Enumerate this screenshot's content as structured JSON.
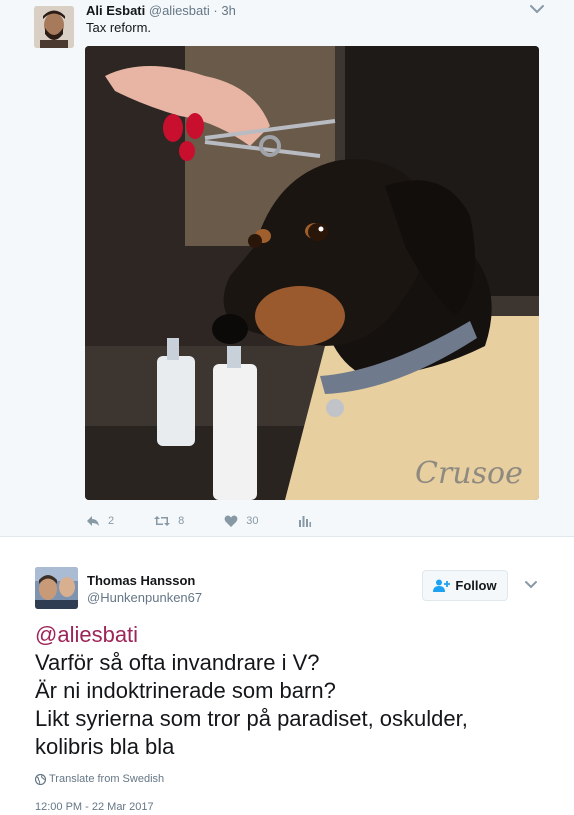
{
  "quoted_tweet": {
    "author_name": "Ali Esbati",
    "author_handle": "@aliesbati",
    "time": "3h",
    "text": "Tax reform.",
    "photo": {
      "watermark": "Crusoe",
      "description_icon": "dachshund-photo"
    },
    "actions": {
      "reply_count": "2",
      "retweet_count": "8",
      "like_count": "30"
    },
    "icons": [
      "reply-icon",
      "retweet-icon",
      "heart-icon",
      "analytics-icon",
      "chevron-down-icon"
    ]
  },
  "reply_tweet": {
    "author_name": "Thomas Hansson",
    "author_handle": "@Hunkenpunken67",
    "follow_label": "Follow",
    "mention": "@aliesbati",
    "lines": [
      "Varför så ofta invandrare i V?",
      "Är ni indoktrinerade som barn?",
      "Likt syrierna som tror på paradiset, oskulder,",
      "kolibris bla bla"
    ],
    "translate_label": "Translate from Swedish",
    "timestamp": "12:00 PM - 22 Mar 2017"
  },
  "colors": {
    "mention": "#9d2557",
    "secondary_text": "#657786",
    "action_icons": "#8899a6",
    "follow_icon": "#1da1f2",
    "tweet_bg": "#f5f8fa"
  }
}
